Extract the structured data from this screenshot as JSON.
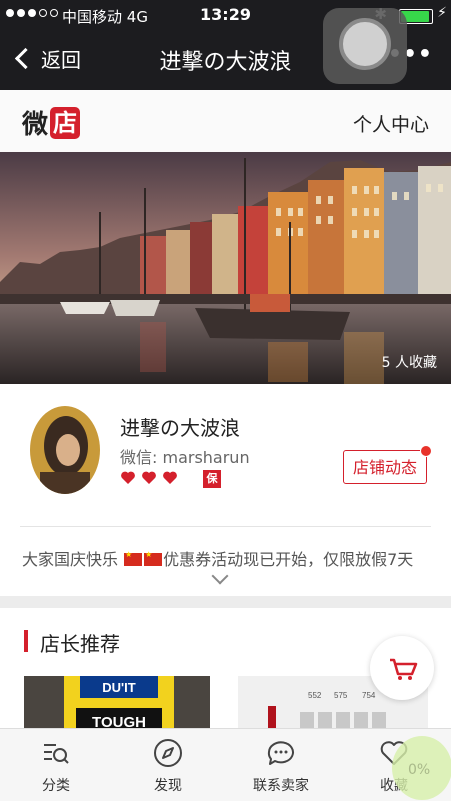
{
  "status_bar": {
    "carrier": "中国移动",
    "network": "4G",
    "time": "13:29"
  },
  "nav": {
    "back_label": "返回",
    "title": "进撃の大波浪"
  },
  "shop_header": {
    "logo_char1": "微",
    "logo_char2": "店",
    "personal_center": "个人中心"
  },
  "banner": {
    "favorites": "5 人收藏"
  },
  "profile": {
    "shop_name": "进撃の大波浪",
    "wechat": "微信: marsharun",
    "hearts": 3,
    "guarantee_badge": "保",
    "dynamic_button": "店铺动态",
    "notice_prefix": "大家国庆快乐",
    "notice_suffix": "优惠券活动现已开始，仅限放假7天"
  },
  "recommend": {
    "title": "店长推荐",
    "product1_text1": "DU'IT",
    "product1_text2": "TOUGH",
    "product2_labels": [
      "552",
      "575",
      "754"
    ]
  },
  "tabs": [
    {
      "label": "分类",
      "icon": "category-search-icon"
    },
    {
      "label": "发现",
      "icon": "compass-icon"
    },
    {
      "label": "联系卖家",
      "icon": "chat-bubble-icon"
    },
    {
      "label": "收藏",
      "icon": "heart-icon"
    }
  ],
  "overlay": {
    "percent": "0%"
  },
  "colors": {
    "accent": "#d4202c",
    "nav_bg": "#1c1c1f"
  }
}
